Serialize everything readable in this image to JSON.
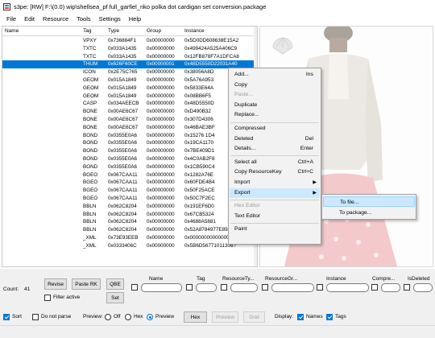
{
  "window": {
    "title": "s3pe: [RW] F:\\(0.0) wip\\shellsea_pf full_garfiel_riko polka dot cardigan set conversion.package"
  },
  "menu": [
    "File",
    "Edit",
    "Resource",
    "Tools",
    "Settings",
    "Help"
  ],
  "columns": [
    "Name",
    "Tag",
    "Type",
    "Group",
    "Instance"
  ],
  "rows": [
    {
      "tag": "VPXY",
      "type": "0x736884F1",
      "group": "0x00000000",
      "instance": "0x5D0DD608638E15A2"
    },
    {
      "tag": "TXTC",
      "type": "0x033A1435",
      "group": "0x00000000",
      "instance": "0x499424A525A406C9"
    },
    {
      "tag": "TXTC",
      "type": "0x033A1435",
      "group": "0x00000000",
      "instance": "0x12FB878F7A1DFCA8"
    },
    {
      "tag": "THUM",
      "type": "0x626F60CE",
      "group": "0x00000001",
      "instance": "0x48D5550D22031A40"
    },
    {
      "tag": "ICON",
      "type": "0x2E75C765",
      "group": "0x00000000",
      "instance": "0x38056A8D"
    },
    {
      "tag": "GEOM",
      "type": "0x015A1849",
      "group": "0x00000000",
      "instance": "0x5A76A953"
    },
    {
      "tag": "GEOM",
      "type": "0x015A1849",
      "group": "0x00000000",
      "instance": "0x5833E64A"
    },
    {
      "tag": "GEOM",
      "type": "0x015A1849",
      "group": "0x00000000",
      "instance": "0x08BB6F5"
    },
    {
      "tag": "CASP",
      "type": "0x034AEECB",
      "group": "0x00000000",
      "instance": "0x48D5550D"
    },
    {
      "tag": "BONE",
      "type": "0x00AE6C67",
      "group": "0x00000000",
      "instance": "0xD490B32"
    },
    {
      "tag": "BONE",
      "type": "0x00AE6C67",
      "group": "0x00000000",
      "instance": "0x307D4306"
    },
    {
      "tag": "BONE",
      "type": "0x00AE6C67",
      "group": "0x00000000",
      "instance": "0x46BAE3BF"
    },
    {
      "tag": "BOND",
      "type": "0x0355E0A6",
      "group": "0x00000000",
      "instance": "0x15276 1D4"
    },
    {
      "tag": "BOND",
      "type": "0x0355E0A6",
      "group": "0x00000000",
      "instance": "0x19CA1170"
    },
    {
      "tag": "BOND",
      "type": "0x0355E0A6",
      "group": "0x00000000",
      "instance": "0x7BE409D1"
    },
    {
      "tag": "BOND",
      "type": "0x0355E0A6",
      "group": "0x00000000",
      "instance": "0x4C0AB2F8"
    },
    {
      "tag": "BOND",
      "type": "0x0355E0A6",
      "group": "0x00000000",
      "instance": "0x1CB590C4"
    },
    {
      "tag": "BGEO",
      "type": "0x067CAA11",
      "group": "0x00000000",
      "instance": "0x1282A76E"
    },
    {
      "tag": "BGEO",
      "type": "0x067CAA11",
      "group": "0x00000000",
      "instance": "0x60FDE4B4"
    },
    {
      "tag": "BGEO",
      "type": "0x067CAA11",
      "group": "0x00000000",
      "instance": "0x50F25ACE"
    },
    {
      "tag": "BGEO",
      "type": "0x067CAA11",
      "group": "0x00000000",
      "instance": "0x50C7F2EC"
    },
    {
      "tag": "BBLN",
      "type": "0x062C8204",
      "group": "0x00000000",
      "instance": "0x191EF6D0"
    },
    {
      "tag": "BBLN",
      "type": "0x062C8204",
      "group": "0x00000000",
      "instance": "0x67CB5324"
    },
    {
      "tag": "BBLN",
      "type": "0x062C8204",
      "group": "0x00000000",
      "instance": "0x4688A5881"
    },
    {
      "tag": "BBLN",
      "type": "0x062C8204",
      "group": "0x00000000",
      "instance": "0x52A8784977E89AF"
    },
    {
      "tag": "_XML",
      "type": "0x73E93EEB",
      "group": "0x00000000",
      "instance": "0x0000000000000000"
    },
    {
      "tag": "_XML",
      "type": "0x0333406C",
      "group": "0x00000000",
      "instance": "0x5B6D56771011306?"
    }
  ],
  "context_menu": {
    "items": [
      {
        "label": "Add...",
        "shortcut": "Ins",
        "disabled": false
      },
      {
        "label": "Copy",
        "shortcut": "",
        "disabled": false
      },
      {
        "label": "Paste...",
        "shortcut": "",
        "disabled": true
      },
      {
        "label": "Duplicate",
        "shortcut": "",
        "disabled": false
      },
      {
        "label": "Replace...",
        "shortcut": "",
        "disabled": false
      },
      {
        "label": "Compressed",
        "shortcut": "",
        "disabled": false
      },
      {
        "label": "Deleted",
        "shortcut": "Del",
        "disabled": false
      },
      {
        "label": "Details...",
        "shortcut": "Enter",
        "disabled": false
      },
      {
        "label": "Select all",
        "shortcut": "Ctrl+A",
        "disabled": false
      },
      {
        "label": "Copy ResourceKey",
        "shortcut": "Ctrl+C",
        "disabled": false
      },
      {
        "label": "Import",
        "shortcut": "",
        "disabled": false,
        "submenu": true
      },
      {
        "label": "Export",
        "shortcut": "",
        "disabled": false,
        "submenu": true,
        "highlighted": true
      },
      {
        "label": "Hex Editor",
        "shortcut": "",
        "disabled": true
      },
      {
        "label": "Text Editor",
        "shortcut": "",
        "disabled": false
      },
      {
        "label": "Paint",
        "shortcut": "",
        "disabled": false
      }
    ]
  },
  "export_submenu": [
    "To file...",
    "To package..."
  ],
  "bottom": {
    "count_label": "Count:",
    "count_value": "41",
    "revise": "Revise",
    "paste_rk": "Paste RK",
    "qbe": "QBE",
    "set": "Set",
    "filter_active": "Filter active",
    "filter_columns": [
      "Name",
      "Tag",
      "ResourceTy...",
      "ResourceGr...",
      "Instance",
      "Compre...",
      "IsDeleted"
    ],
    "sort": "Sort",
    "do_not_parse": "Do not parse",
    "preview_label": "Preview:",
    "radio_off": "Off",
    "radio_hex": "Hex",
    "radio_preview": "Preview",
    "hex_btn": "Hex",
    "preview_btn": "Preview",
    "grid_btn": "Grid",
    "display_label": "Display:",
    "names": "Names",
    "tags": "Tags"
  },
  "colors": {
    "selection": "#0078d7",
    "menu_highlight": "#cce8ff"
  }
}
